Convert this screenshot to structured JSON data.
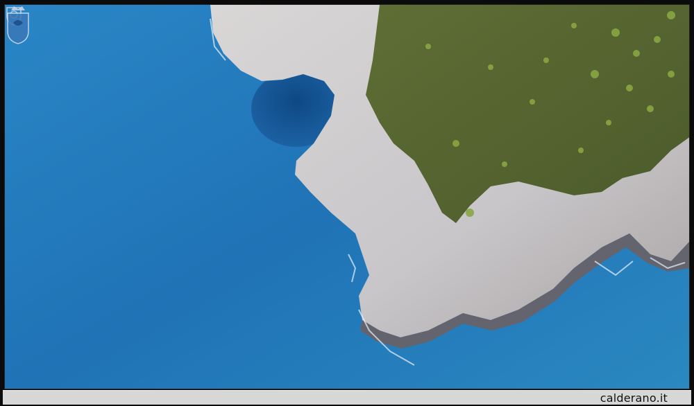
{
  "image": {
    "subject": "aerial-coastline",
    "colors": {
      "sea_deep": "#1e6fb0",
      "sea_shallow": "#2f86c4",
      "rock": "#cfcfd2",
      "rock_shadow": "#7a6f70",
      "vegetation": "#6f7f3a",
      "caption_bar": "#d7d7d7"
    }
  },
  "caption": {
    "site_label": "calderano.it"
  },
  "watermarks": {
    "top_left_icon": "crest-icon",
    "bottom_right_icon": "coat-of-arms-icon"
  }
}
